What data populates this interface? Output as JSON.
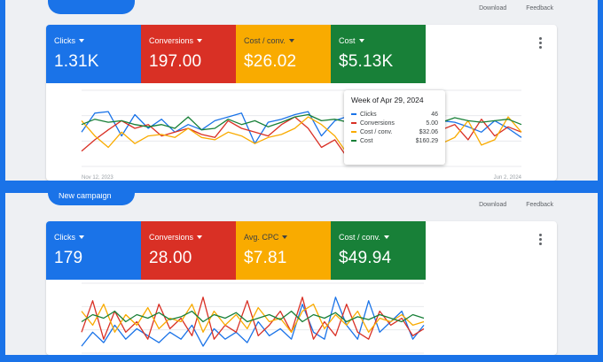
{
  "top": {
    "pill_label": "",
    "links": [
      "Download",
      "Feedback"
    ],
    "tiles": [
      {
        "label": "Clicks",
        "value": "1.31K",
        "color": "#1a73e8"
      },
      {
        "label": "Conversions",
        "value": "197.00",
        "color": "#d93025"
      },
      {
        "label": "Cost / conv.",
        "value": "$26.02",
        "color": "#f9ab00"
      },
      {
        "label": "Cost",
        "value": "$5.13K",
        "color": "#188038"
      }
    ],
    "x_labels": [
      "Nov 12, 2023",
      "Jun 2, 2024"
    ],
    "tooltip": {
      "title": "Week of Apr 29, 2024",
      "rows": [
        {
          "name": "Clicks",
          "value": "46",
          "color": "#1a73e8"
        },
        {
          "name": "Conversions",
          "value": "5.00",
          "color": "#d93025"
        },
        {
          "name": "Cost / conv.",
          "value": "$32.06",
          "color": "#f9ab00"
        },
        {
          "name": "Cost",
          "value": "$160.29",
          "color": "#188038"
        }
      ]
    }
  },
  "bottom": {
    "pill_label": "New campaign",
    "links": [
      "Download",
      "Feedback"
    ],
    "tiles": [
      {
        "label": "Clicks",
        "value": "179",
        "color": "#1a73e8"
      },
      {
        "label": "Conversions",
        "value": "28.00",
        "color": "#d93025"
      },
      {
        "label": "Avg. CPC",
        "value": "$7.81",
        "color": "#f9ab00"
      },
      {
        "label": "Cost / conv.",
        "value": "$49.94",
        "color": "#188038"
      }
    ]
  },
  "chart_data": [
    {
      "type": "line",
      "series": [
        {
          "name": "Clicks",
          "color": "#1a73e8",
          "values": [
            45,
            70,
            72,
            40,
            68,
            50,
            62,
            45,
            55,
            48,
            60,
            65,
            70,
            30,
            58,
            62,
            68,
            72,
            40,
            60,
            66,
            55,
            62,
            52,
            58,
            35,
            62,
            60,
            58,
            52,
            45,
            60,
            50,
            38
          ]
        },
        {
          "name": "Conversions",
          "color": "#d93025",
          "values": [
            20,
            35,
            48,
            60,
            50,
            55,
            40,
            45,
            50,
            42,
            38,
            60,
            50,
            45,
            40,
            55,
            65,
            50,
            25,
            35,
            10,
            45,
            55,
            42,
            60,
            55,
            50,
            48,
            55,
            35,
            62,
            40,
            52,
            45
          ]
        },
        {
          "name": "Cost / conv.",
          "color": "#f9ab00",
          "values": [
            60,
            40,
            25,
            45,
            30,
            40,
            42,
            38,
            50,
            38,
            35,
            45,
            40,
            30,
            38,
            42,
            50,
            65,
            55,
            40,
            15,
            38,
            40,
            30,
            35,
            45,
            68,
            30,
            38,
            60,
            28,
            35,
            65,
            45
          ]
        },
        {
          "name": "Cost",
          "color": "#188038",
          "values": [
            55,
            62,
            58,
            60,
            55,
            52,
            55,
            50,
            65,
            48,
            50,
            62,
            55,
            60,
            52,
            58,
            65,
            68,
            60,
            62,
            58,
            64,
            66,
            62,
            70,
            60,
            62,
            58,
            64,
            60,
            58,
            60,
            62,
            55
          ]
        }
      ]
    },
    {
      "type": "line",
      "series": [
        {
          "name": "Clicks",
          "color": "#1a73e8",
          "values": [
            10,
            30,
            15,
            40,
            20,
            35,
            25,
            15,
            30,
            20,
            40,
            10,
            35,
            20,
            30,
            15,
            45,
            25,
            35,
            20,
            70,
            30,
            20,
            80,
            40,
            20,
            75,
            30,
            45,
            60,
            20,
            40
          ]
        },
        {
          "name": "Conversions",
          "color": "#d93025",
          "values": [
            30,
            75,
            20,
            60,
            30,
            45,
            20,
            70,
            35,
            50,
            25,
            80,
            20,
            40,
            30,
            75,
            25,
            40,
            60,
            30,
            80,
            20,
            45,
            25,
            70,
            30,
            20,
            60,
            40,
            50,
            25,
            35
          ]
        },
        {
          "name": "Avg. CPC",
          "color": "#f9ab00",
          "values": [
            60,
            40,
            70,
            30,
            55,
            40,
            65,
            35,
            50,
            45,
            70,
            30,
            60,
            40,
            55,
            35,
            65,
            45,
            50,
            30,
            60,
            70,
            35,
            55,
            40,
            60,
            30,
            50,
            45,
            55,
            40,
            45
          ]
        },
        {
          "name": "Cost / conv.",
          "color": "#188038",
          "values": [
            45,
            55,
            50,
            60,
            45,
            55,
            50,
            58,
            48,
            52,
            60,
            45,
            55,
            50,
            58,
            45,
            50,
            55,
            48,
            60,
            45,
            55,
            50,
            58,
            45,
            52,
            48,
            55,
            50,
            45,
            55,
            50
          ]
        }
      ]
    }
  ]
}
